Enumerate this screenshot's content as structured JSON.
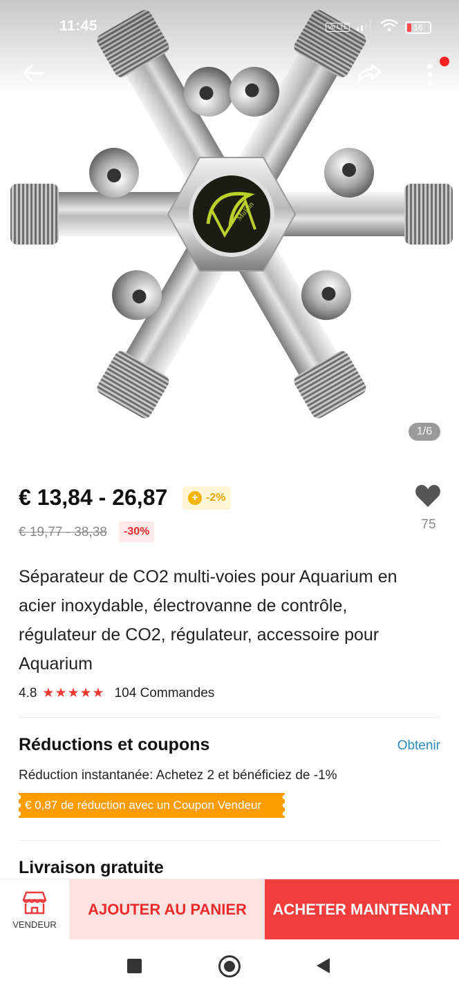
{
  "status_bar": {
    "time": "11:45",
    "network": "Vo LTE",
    "battery": "16"
  },
  "gallery": {
    "counter": "1/6",
    "logo_text": "MuFan"
  },
  "price": {
    "range": "€ 13,84 - 26,87",
    "coin_discount": "-2%",
    "original_range": "€ 19,77 - 38,38",
    "discount_percent": "-30%"
  },
  "wishlist": {
    "count": "75"
  },
  "product": {
    "title": "Séparateur de CO2 multi-voies pour Aquarium en acier inoxydable, électrovanne de contrôle, régulateur de CO2, régulateur, accessoire pour Aquarium",
    "rating": "4.8",
    "stars": "★★★★★",
    "orders": "104 Commandes"
  },
  "coupons": {
    "title": "Réductions et coupons",
    "action": "Obtenir",
    "instant": "Réduction instantanée: Achetez 2 et bénéficiez de -1%",
    "ticket": "€ 0,87 de réduction avec un Coupon Vendeur"
  },
  "shipping": {
    "title": "Livraison gratuite"
  },
  "action_bar": {
    "vendor_label": "VENDEUR",
    "cart_label": "AJOUTER AU PANIER",
    "buy_label": "ACHETER MAINTENANT"
  },
  "colors": {
    "accent_red": "#f23d3d",
    "coupon_orange": "#ff9c00",
    "link_blue": "#2a8ab8"
  }
}
